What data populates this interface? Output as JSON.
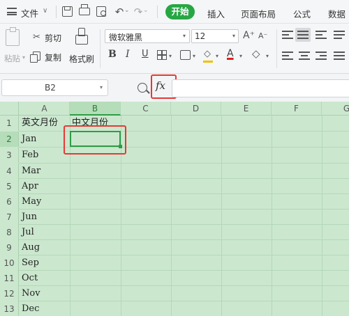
{
  "menubar": {
    "file_label": "文件",
    "tabs": [
      {
        "label": "开始",
        "active": true
      },
      {
        "label": "插入"
      },
      {
        "label": "页面布局"
      },
      {
        "label": "公式"
      },
      {
        "label": "数据"
      }
    ]
  },
  "ribbon": {
    "paste_label": "粘贴",
    "cut_label": "剪切",
    "copy_label": "复制",
    "format_painter_label": "格式刷",
    "font_name": "微软雅黑",
    "font_size": "12",
    "bold": "B",
    "italic": "I",
    "underline": "U",
    "font_color_glyph": "A",
    "grow_glyph": "A⁺",
    "shrink_glyph": "A⁻"
  },
  "formula_bar": {
    "name_box": "B2",
    "fx_label": "fx",
    "formula": ""
  },
  "sheet": {
    "columns": [
      "A",
      "B",
      "C",
      "D",
      "E",
      "F",
      "G"
    ],
    "active_column": "B",
    "rows": [
      "1",
      "2",
      "3",
      "4",
      "5",
      "6",
      "7",
      "8",
      "9",
      "10",
      "11",
      "12",
      "13"
    ],
    "active_row": "2",
    "col_a": [
      "英文月份",
      "Jan",
      "Feb",
      "Mar",
      "Apr",
      "May",
      "Jun",
      "Jul",
      "Aug",
      "Sep",
      "Oct",
      "Nov",
      "Dec"
    ],
    "b1": "中文月份",
    "selected_cell": "B2"
  },
  "colors": {
    "accent": "#27a744",
    "grid_bg": "#cbe8cf",
    "highlight": "#e53935"
  }
}
